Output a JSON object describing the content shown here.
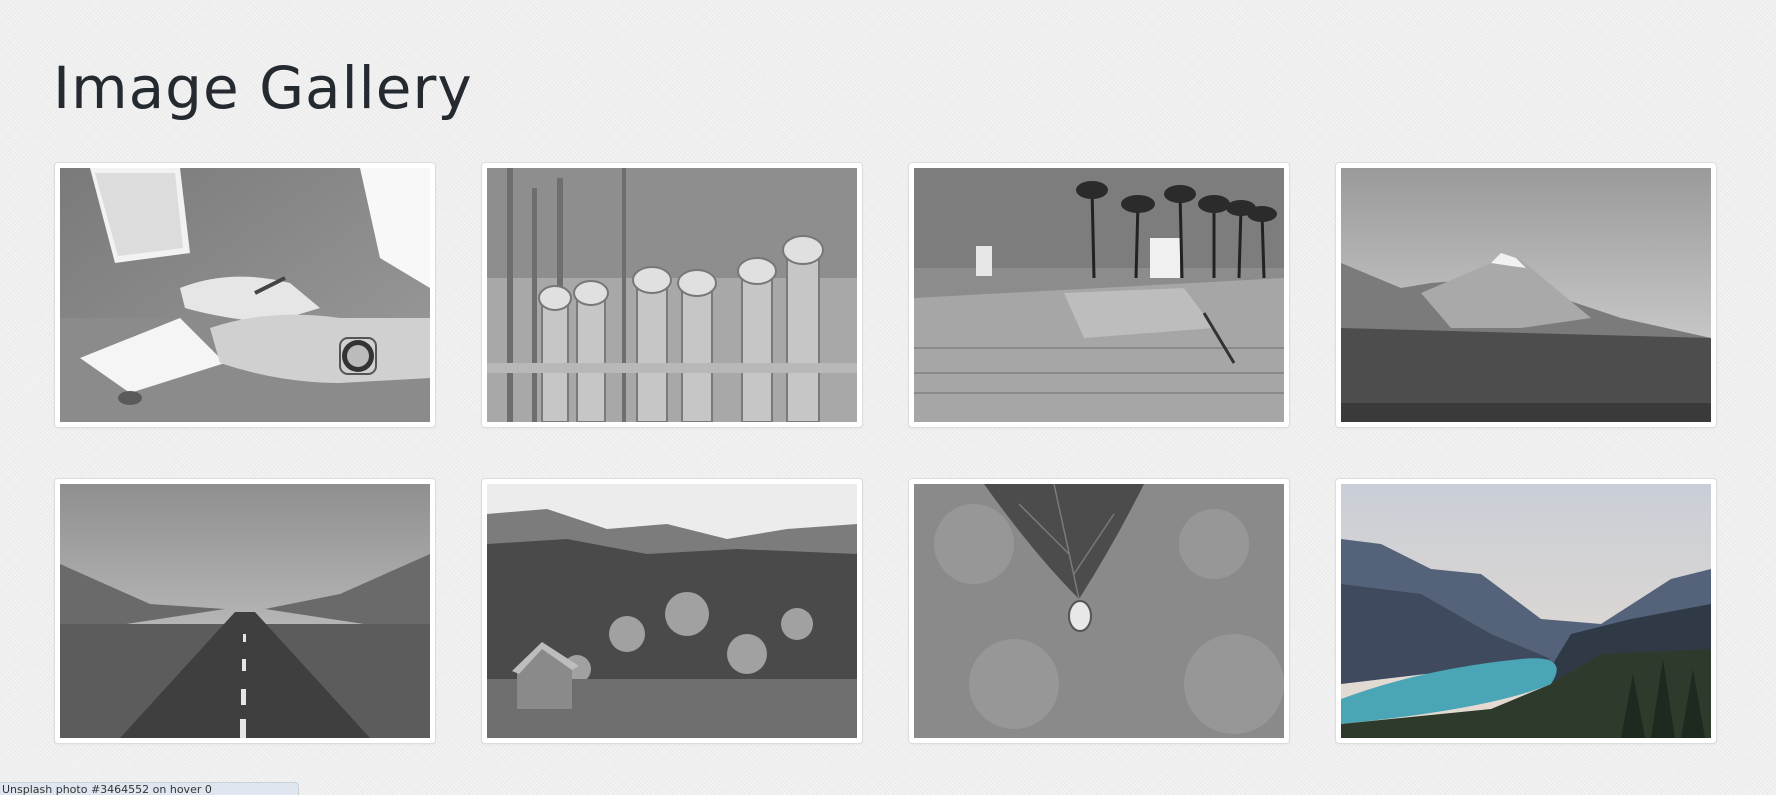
{
  "page": {
    "title": "Image Gallery"
  },
  "gallery": {
    "items": [
      {
        "name": "gallery-image-writing-notebook",
        "depicts": "hands writing in a notebook next to a laptop"
      },
      {
        "name": "gallery-image-wooden-fence",
        "depicts": "wooden fence posts with caps"
      },
      {
        "name": "gallery-image-skatepark-palms",
        "depicts": "skatepark with palm trees"
      },
      {
        "name": "gallery-image-mountain",
        "depicts": "snow-capped mountain above tree line"
      },
      {
        "name": "gallery-image-open-road",
        "depicts": "empty road through a valley"
      },
      {
        "name": "gallery-image-cabin-forest",
        "depicts": "small cabin at the edge of a forest"
      },
      {
        "name": "gallery-image-leaf-droplet",
        "depicts": "water droplet hanging from a leaf"
      },
      {
        "name": "gallery-image-mountain-lake",
        "depicts": "turquoise mountain lake between peaks"
      }
    ]
  },
  "status_bar": {
    "text": "Unsplash photo #3464552 on hover 0"
  },
  "colors": {
    "background": "#efefef",
    "title": "#252a31",
    "card_border": "#dcdcdc",
    "lake": "#4aa6b6"
  }
}
